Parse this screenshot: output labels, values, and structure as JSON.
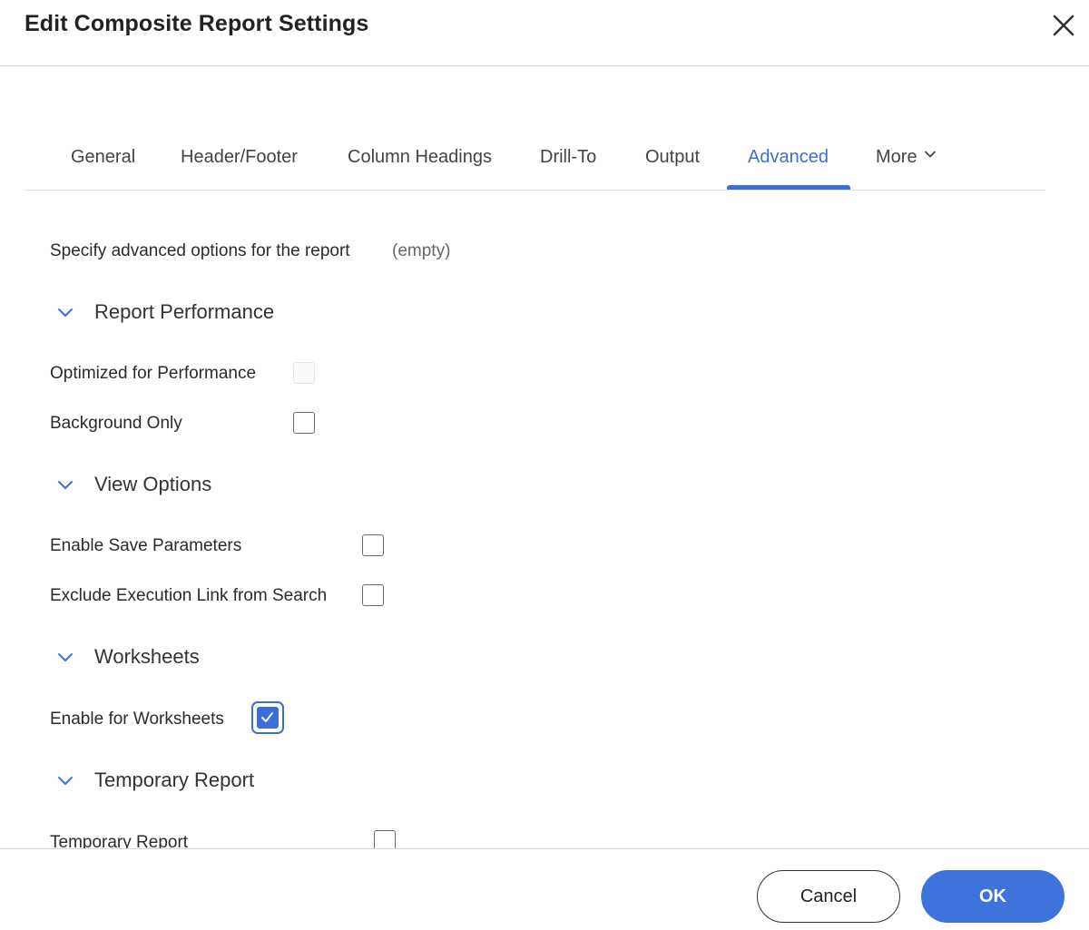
{
  "dialog": {
    "title": "Edit Composite Report Settings"
  },
  "tabs": [
    {
      "label": "General",
      "active": false
    },
    {
      "label": "Header/Footer",
      "active": false
    },
    {
      "label": "Column Headings",
      "active": false
    },
    {
      "label": "Drill-To",
      "active": false
    },
    {
      "label": "Output",
      "active": false
    },
    {
      "label": "Advanced",
      "active": true
    },
    {
      "label": "More",
      "active": false
    }
  ],
  "advanced": {
    "intro_label": "Specify advanced options for the report",
    "intro_value": "(empty)",
    "sections": [
      {
        "title": "Report Performance",
        "expanded": true,
        "options": [
          {
            "label": "Optimized for Performance",
            "checked": false,
            "disabled": true
          },
          {
            "label": "Background Only",
            "checked": false,
            "disabled": false
          }
        ]
      },
      {
        "title": "View Options",
        "expanded": true,
        "options": [
          {
            "label": "Enable Save Parameters",
            "checked": false,
            "disabled": false
          },
          {
            "label": "Exclude Execution Link from Search",
            "checked": false,
            "disabled": false
          }
        ]
      },
      {
        "title": "Worksheets",
        "expanded": true,
        "options": [
          {
            "label": "Enable for Worksheets",
            "checked": true,
            "disabled": false,
            "focused": true
          }
        ]
      },
      {
        "title": "Temporary Report",
        "expanded": true,
        "options": [
          {
            "label": "Temporary Report",
            "checked": false,
            "disabled": false
          }
        ]
      }
    ]
  },
  "footer": {
    "cancel_label": "Cancel",
    "ok_label": "OK"
  },
  "colors": {
    "accent": "#3b6fd8",
    "text": "#2b2b2b",
    "divider": "#d4d4d4"
  },
  "icons": {
    "close": "close-icon",
    "section_toggle": "chevron-down-icon",
    "more": "chevron-down-icon",
    "check": "checkmark-icon"
  }
}
